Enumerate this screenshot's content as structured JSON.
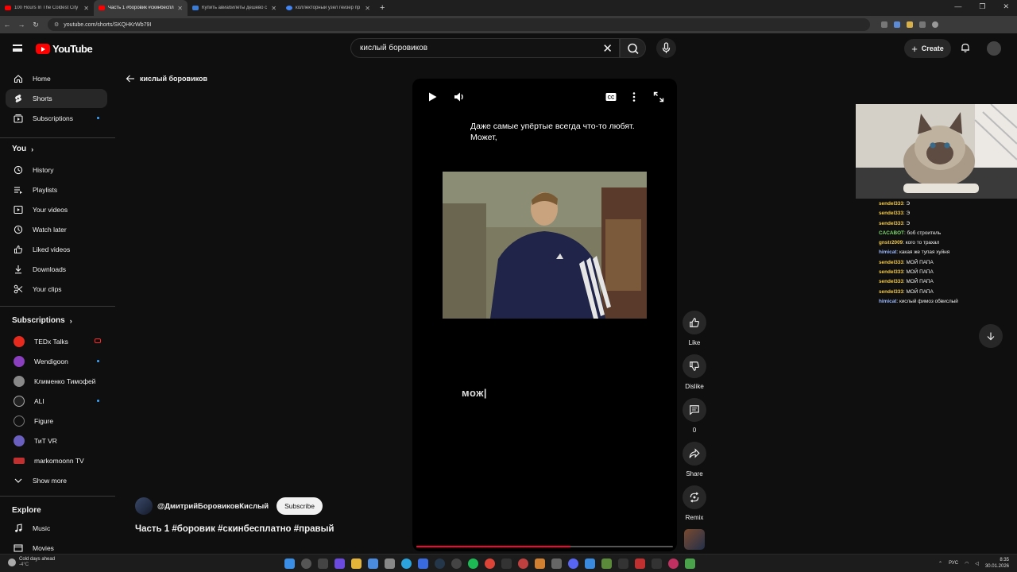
{
  "browser": {
    "tabs": [
      {
        "title": "100 Hours In The Coldest City",
        "color": "#ff0000"
      },
      {
        "title": "Часть 1 #боровик #скинбесплатно",
        "color": "#ff0000"
      },
      {
        "title": "Купить авиабилеты дешево с",
        "color": "#3a7bd5"
      },
      {
        "title": "коллекторный узел гейзер пр",
        "color": "#4285f4"
      }
    ],
    "url": "youtube.com/shorts/SKQHKrWb79I"
  },
  "youtube": {
    "logo_text": "YouTube",
    "search_value": "кислый боровиков",
    "create_label": "Create"
  },
  "sidebar": {
    "main": [
      {
        "label": "Home",
        "icon": "home-icon"
      },
      {
        "label": "Shorts",
        "icon": "shorts-icon"
      },
      {
        "label": "Subscriptions",
        "icon": "subscriptions-icon"
      }
    ],
    "you_heading": "You",
    "you": [
      {
        "label": "History",
        "icon": "history-icon"
      },
      {
        "label": "Playlists",
        "icon": "playlists-icon"
      },
      {
        "label": "Your videos",
        "icon": "your-videos-icon"
      },
      {
        "label": "Watch later",
        "icon": "watch-later-icon"
      },
      {
        "label": "Liked videos",
        "icon": "liked-videos-icon"
      },
      {
        "label": "Downloads",
        "icon": "downloads-icon"
      },
      {
        "label": "Your clips",
        "icon": "clips-icon"
      }
    ],
    "subs_heading": "Subscriptions",
    "subs": [
      {
        "label": "TEDx Talks",
        "color": "#e62b1e"
      },
      {
        "label": "Wendigoon",
        "color": "#8a3fbf"
      },
      {
        "label": "Клименко Тимофей",
        "color": "#888888"
      },
      {
        "label": "ALI",
        "color": "#222222"
      },
      {
        "label": "Figure",
        "color": "#111111"
      },
      {
        "label": "ТиТ VR",
        "color": "#6a5fbf"
      },
      {
        "label": "markomoonn TV",
        "color": "#c03030"
      }
    ],
    "show_more": "Show more",
    "explore_heading": "Explore",
    "explore": [
      {
        "label": "Music",
        "icon": "music-icon"
      },
      {
        "label": "Movies",
        "icon": "movies-icon"
      }
    ]
  },
  "shorts": {
    "back_label": "кислый боровиков",
    "caption": "Даже самые упёртые всегда что-то любят. Может,",
    "typed_text": "мож|",
    "progress": 0.6,
    "channel": "@ДмитрийБоровиковКислый",
    "subscribe_label": "Subscribe",
    "title": "Часть 1 #боровик #скинбесплатно #правый",
    "actions": {
      "like": "Like",
      "dislike": "Dislike",
      "comments": "0",
      "share": "Share",
      "remix": "Remix"
    }
  },
  "chat": [
    {
      "user": "sendel333",
      "color": "#f0c84a",
      "text": "Э"
    },
    {
      "user": "sendel333",
      "color": "#f0c84a",
      "text": "Э"
    },
    {
      "user": "sendel333",
      "color": "#f0c84a",
      "text": "Э"
    },
    {
      "user": "CACABOT",
      "color": "#7bd86a",
      "text": "боб строитель"
    },
    {
      "user": "gnstr2009",
      "color": "#f0c84a",
      "text": "кого то трахал"
    },
    {
      "user": "himicat",
      "color": "#9ab8ff",
      "text": "какая же тупая хуйня"
    },
    {
      "user": "sendel333",
      "color": "#f0c84a",
      "text": "МОЙ ПАПА"
    },
    {
      "user": "sendel333",
      "color": "#f0c84a",
      "text": "МОЙ ПАПА"
    },
    {
      "user": "sendel333",
      "color": "#f0c84a",
      "text": "МОЙ ПАПА"
    },
    {
      "user": "sendel333",
      "color": "#f0c84a",
      "text": "МОЙ ПАПА"
    },
    {
      "user": "himicat",
      "color": "#9ab8ff",
      "text": "кислый фимоз обвислый"
    }
  ],
  "taskbar": {
    "weather_line1": "Cold days ahead",
    "weather_line2": "-4°C",
    "lang": "РУС",
    "time": "8:35",
    "date": "30.01.2026"
  }
}
